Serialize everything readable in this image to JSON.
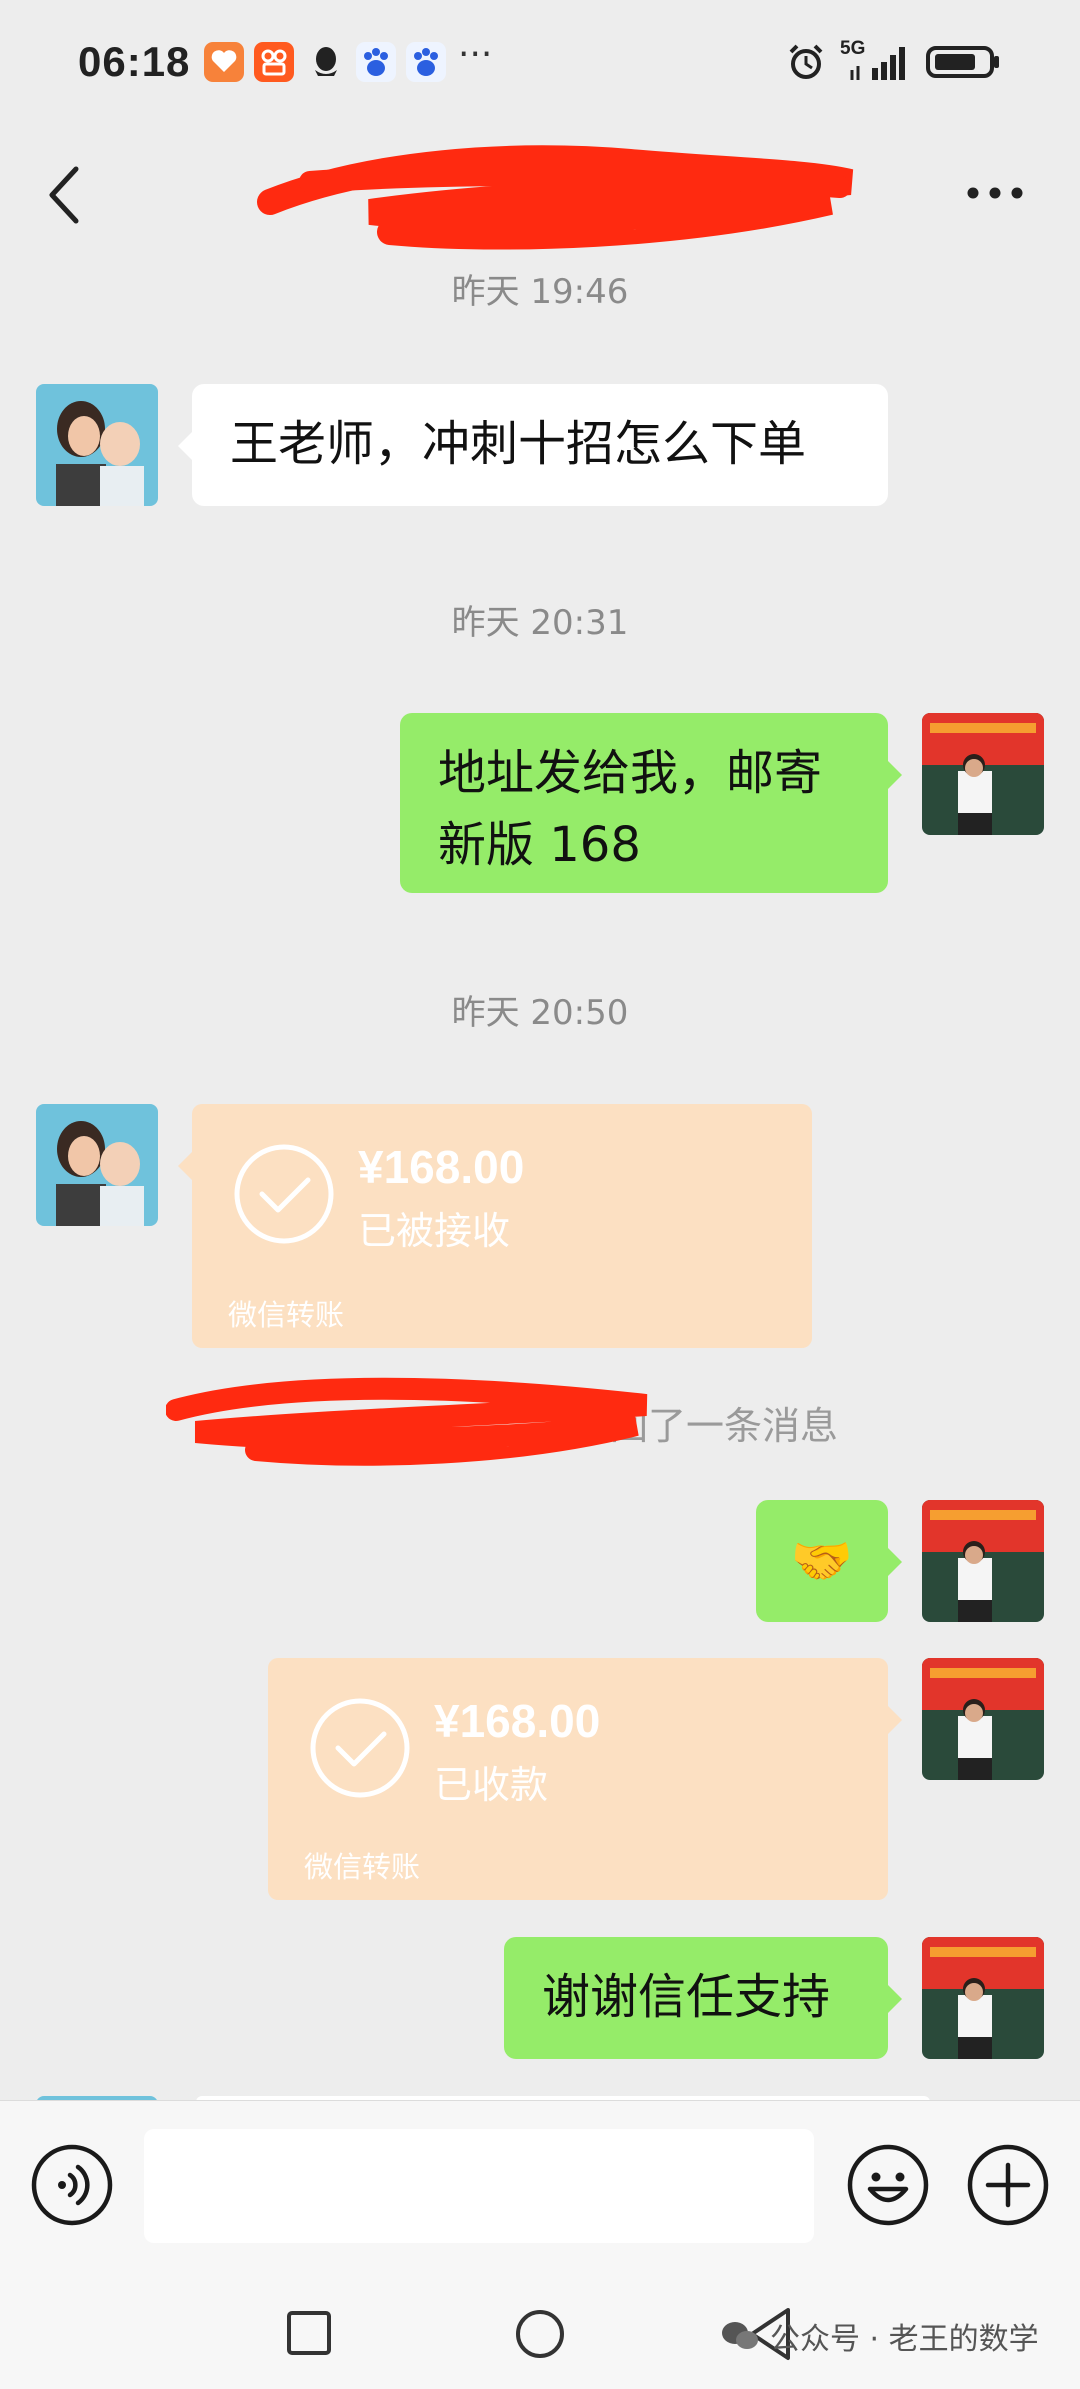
{
  "status_bar": {
    "time": "06:18",
    "network": "5G",
    "more_indicator": "···"
  },
  "header": {
    "title": "",
    "back_icon": "chevron-left-icon",
    "more_label": "···"
  },
  "messages": {
    "t1": "昨天 19:46",
    "m1": "王老师，冲刺十招怎么下单",
    "t2": "昨天 20:31",
    "m2": "地址发给我，邮寄新版 168",
    "t3": "昨天 20:50",
    "transfer1": {
      "amount": "¥168.00",
      "status": "已被接收",
      "label": "微信转账"
    },
    "recall": "撤回了一条消息",
    "m3_emoji": "🤝",
    "transfer2": {
      "amount": "¥168.00",
      "status": "已收款",
      "label": "微信转账"
    },
    "m4": "谢谢信任支持"
  },
  "input_bar": {
    "value": "",
    "icons": [
      "voice-icon",
      "emoji-icon",
      "plus-icon"
    ]
  },
  "nav": {
    "icons": [
      "recent-apps-icon",
      "home-icon",
      "back-icon"
    ],
    "watermark": "公众号 · 老王的数学"
  },
  "colors": {
    "bg": "#ededed",
    "bubble_right": "#95ec69",
    "bubble_left": "#ffffff",
    "transfer": "#fce0c2",
    "redaction": "#ff2a10"
  }
}
